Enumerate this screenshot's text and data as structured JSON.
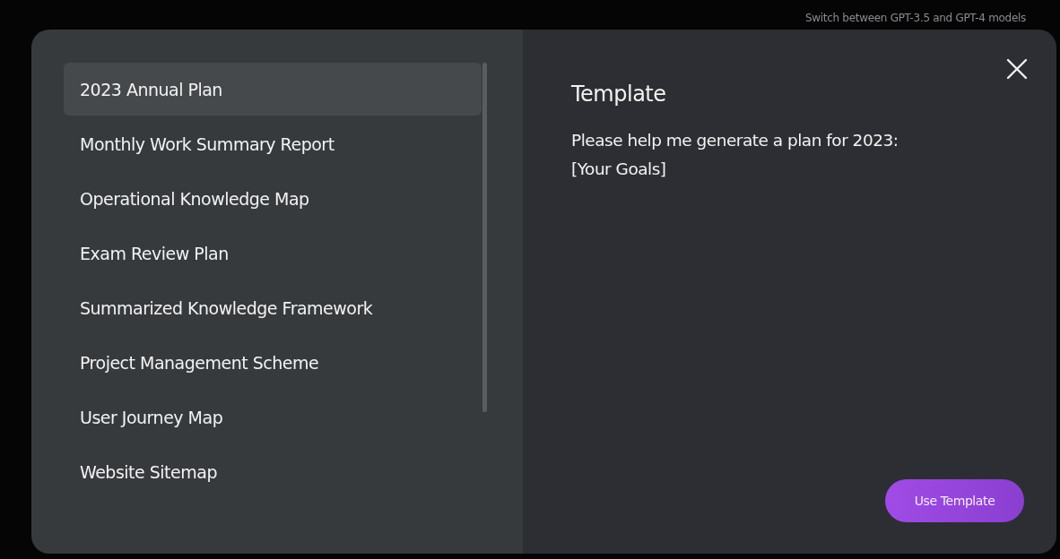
{
  "background_hint": "Switch between GPT-3.5 and GPT-4 models",
  "templates": [
    {
      "label": "2023 Annual Plan",
      "selected": true
    },
    {
      "label": "Monthly Work Summary Report",
      "selected": false
    },
    {
      "label": "Operational Knowledge Map",
      "selected": false
    },
    {
      "label": "Exam Review Plan",
      "selected": false
    },
    {
      "label": "Summarized Knowledge Framework",
      "selected": false
    },
    {
      "label": "Project Management Scheme",
      "selected": false
    },
    {
      "label": "User Journey Map",
      "selected": false
    },
    {
      "label": "Website Sitemap",
      "selected": false
    }
  ],
  "detail": {
    "title": "Template",
    "body": [
      "Please help me generate a plan for 2023:",
      "[Your Goals]"
    ]
  },
  "button": "Use Template"
}
